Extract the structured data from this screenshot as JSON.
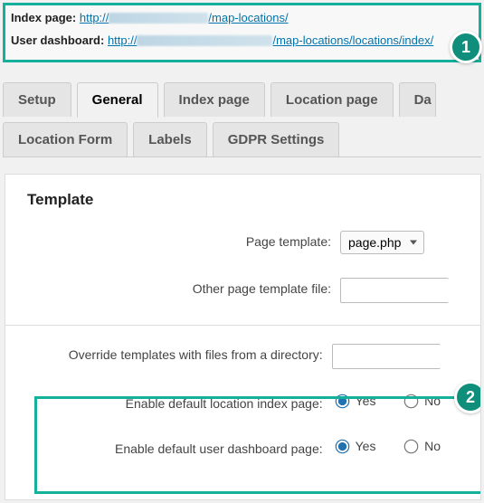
{
  "callouts": {
    "one": "1",
    "two": "2"
  },
  "info": {
    "index_label": "Index page:",
    "index_prefix": "http://",
    "index_suffix": "/map-locations/",
    "dash_label": "User dashboard:",
    "dash_prefix": "http://",
    "dash_suffix": "/map-locations/locations/index/"
  },
  "tabs": {
    "setup": "Setup",
    "general": "General",
    "index": "Index page",
    "location": "Location page",
    "partial": "Da",
    "form": "Location Form",
    "labels": "Labels",
    "gdpr": "GDPR Settings"
  },
  "section_title": "Template",
  "fields": {
    "page_template": {
      "label": "Page template:",
      "value": "page.php"
    },
    "other_template": {
      "label": "Other page template file:",
      "value": ""
    },
    "override": {
      "label": "Override templates with files from a directory:",
      "value": ""
    },
    "enable_index": {
      "label": "Enable default location index page:",
      "yes": "Yes",
      "no": "No"
    },
    "enable_dash": {
      "label": "Enable default user dashboard page:",
      "yes": "Yes",
      "no": "No"
    }
  }
}
